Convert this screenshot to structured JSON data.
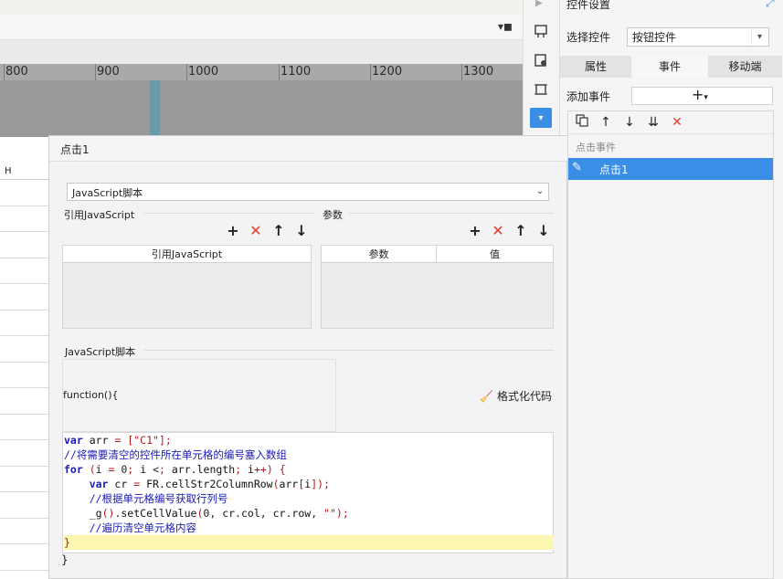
{
  "ruler": {
    "ticks": [
      "800",
      "900",
      "1000",
      "1100",
      "1200",
      "1300"
    ]
  },
  "sheet": {
    "column_header": "H"
  },
  "panel": {
    "title": "控件设置",
    "select_label": "选择控件",
    "select_value": "按钮控件",
    "tabs": [
      "属性",
      "事件",
      "移动端"
    ],
    "active_tab": "事件",
    "add_event_label": "添加事件",
    "add_event_button": "+",
    "event_group_label": "点击事件",
    "events": [
      {
        "label": "点击1",
        "selected": true
      }
    ]
  },
  "dialog": {
    "title": "点击1",
    "type_select": "JavaScript脚本",
    "ref_section_label": "引用JavaScript",
    "param_section_label": "参数",
    "ref_table_header": "引用JavaScript",
    "param_table_headers": [
      "参数",
      "值"
    ],
    "script_section_label": "JavaScript脚本",
    "function_signature": "function(){",
    "format_button": "格式化代码",
    "closing_brace": "}",
    "code_lines": [
      "var arr = [\"C1\"];",
      "//将需要清空的控件所在单元格的编号塞入数组",
      "for (i = 0; i < arr.length; i++) {",
      "    var cr = FR.cellStr2ColumnRow(arr[i]);",
      "    //根据单元格编号获取行列号",
      "    _g().setCellValue(0, cr.col, cr.row, \"\");",
      "    //遍历清空单元格内容",
      "}"
    ]
  },
  "colors": {
    "accent": "#3a8ee6",
    "delete_red": "#e03b2f",
    "code_keyword": "#1a1ab8",
    "code_string": "#b01818",
    "highlight_line": "#fbf7b2"
  }
}
